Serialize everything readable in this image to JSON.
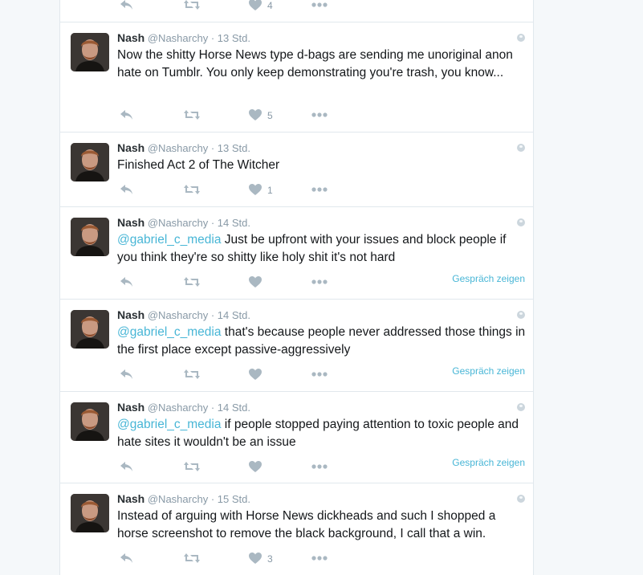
{
  "colors": {
    "link": "#1da1f2",
    "icon": "#aab8c2",
    "meta": "#8899a6",
    "border": "#e1e8ed"
  },
  "icons": {
    "reply": "reply-icon",
    "retweet": "retweet-icon",
    "like": "heart-icon",
    "more": "more-dots-icon",
    "privacy": "globe-icon"
  },
  "top_partial": {
    "like_count": "4"
  },
  "tweets": [
    {
      "name": "Nash",
      "handle": "@Nasharchy",
      "sep": "·",
      "time": "13 Std.",
      "text": "Now the shitty Horse News type d-bags are sending me unoriginal anon hate on Tumblr. You only keep demonstrating you're trash, you know...",
      "likes": "5"
    },
    {
      "name": "Nash",
      "handle": "@Nasharchy",
      "sep": "·",
      "time": "13 Std.",
      "text": "Finished Act 2 of The Witcher",
      "likes": "1"
    },
    {
      "name": "Nash",
      "handle": "@Nasharchy",
      "sep": "·",
      "time": "14 Std.",
      "mention": "@gabriel_c_media",
      "text": " Just be upfront with your issues and block people if you think they're so shitty like holy shit it's not hard",
      "show_conversation": "Gespräch zeigen"
    },
    {
      "name": "Nash",
      "handle": "@Nasharchy",
      "sep": "·",
      "time": "14 Std.",
      "mention": "@gabriel_c_media",
      "text": " that's because people never addressed those things in the first place except passive-aggressively",
      "show_conversation": "Gespräch zeigen"
    },
    {
      "name": "Nash",
      "handle": "@Nasharchy",
      "sep": "·",
      "time": "14 Std.",
      "mention": "@gabriel_c_media",
      "text": " if people stopped paying attention to toxic people and hate sites it wouldn't be an issue",
      "show_conversation": "Gespräch zeigen"
    },
    {
      "name": "Nash",
      "handle": "@Nasharchy",
      "sep": "·",
      "time": "15 Std.",
      "text": "Instead of arguing with Horse News dickheads and such I shopped a horse screenshot to remove the black background, I call that a win.",
      "likes": "3"
    }
  ]
}
